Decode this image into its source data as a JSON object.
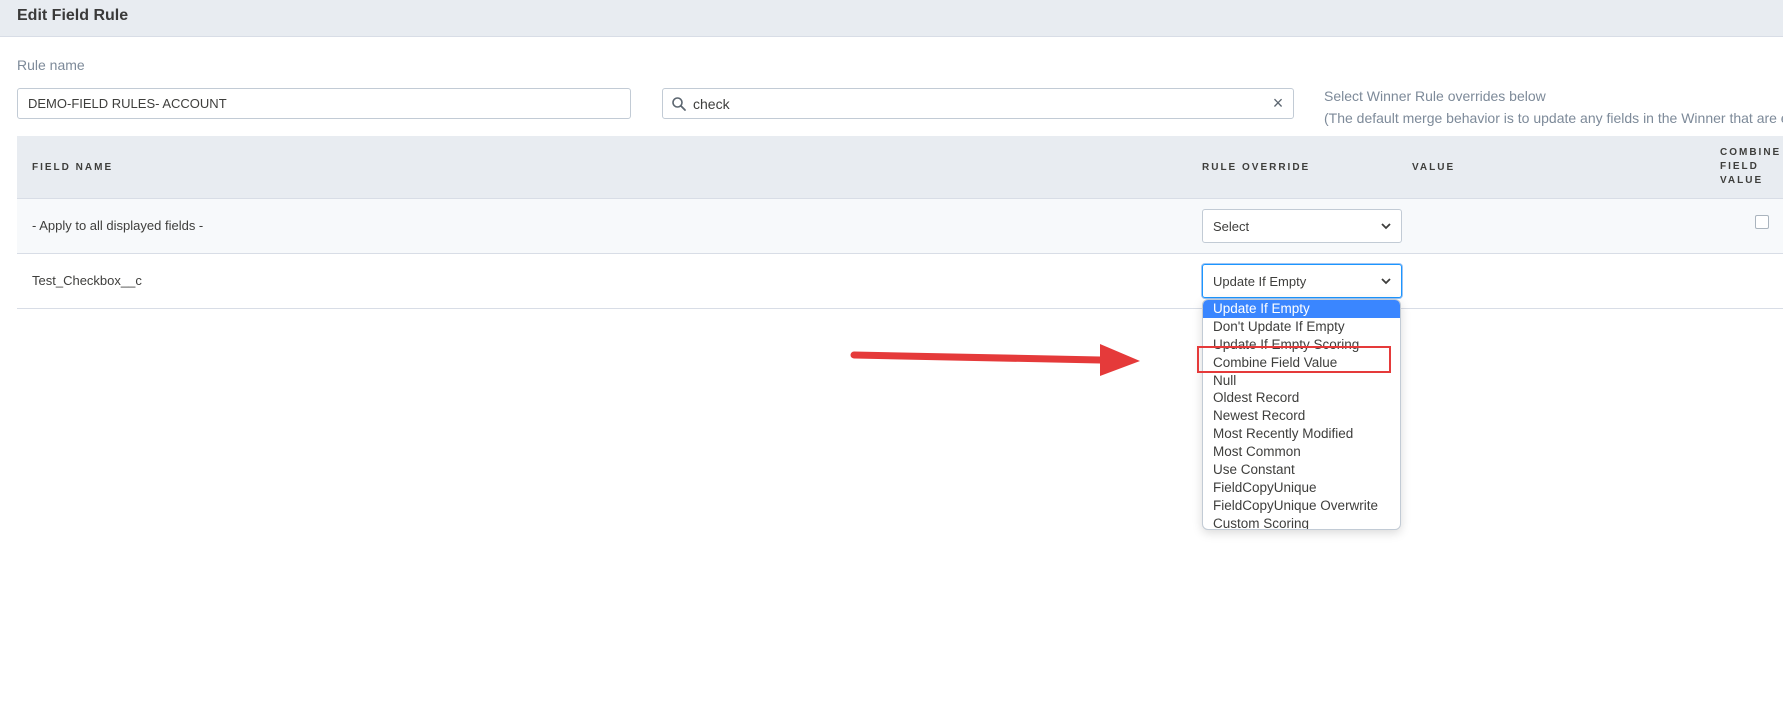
{
  "header": {
    "title": "Edit Field Rule"
  },
  "form": {
    "rule_name_label": "Rule name",
    "rule_name_value": "DEMO-FIELD RULES- ACCOUNT",
    "search_value": "check",
    "winner_title": "Select Winner Rule overrides below",
    "winner_desc": "(The default merge behavior is to update any fields in the Winner that are e"
  },
  "table": {
    "headers": {
      "field_name": "FIELD NAME",
      "rule_override": "RULE OVERRIDE",
      "value": "VALUE",
      "combine_line1": "COMBINE",
      "combine_line2": "FIELD",
      "combine_line3": "VALUE"
    },
    "rows": [
      {
        "label": "- Apply to all displayed fields -",
        "override": "Select"
      },
      {
        "label": "Test_Checkbox__c",
        "override": "Update If Empty"
      }
    ]
  },
  "dropdown": {
    "options": [
      "Update If Empty",
      "Don't Update If Empty",
      "Update If Empty Scoring",
      "Combine Field Value",
      "Null",
      "Oldest Record",
      "Newest Record",
      "Most Recently Modified",
      "Most Common",
      "Use Constant",
      "FieldCopyUnique",
      "FieldCopyUnique Overwrite",
      "Custom Scoring"
    ],
    "selected": "Update If Empty",
    "highlighted": "Combine Field Value"
  },
  "colors": {
    "accent": "#3a86ff",
    "annotation_red": "#e53a3a",
    "header_bg": "#e8ecf1"
  },
  "icons": [
    "search-icon",
    "clear-icon",
    "chevron-down-icon",
    "arrow-annotation"
  ]
}
